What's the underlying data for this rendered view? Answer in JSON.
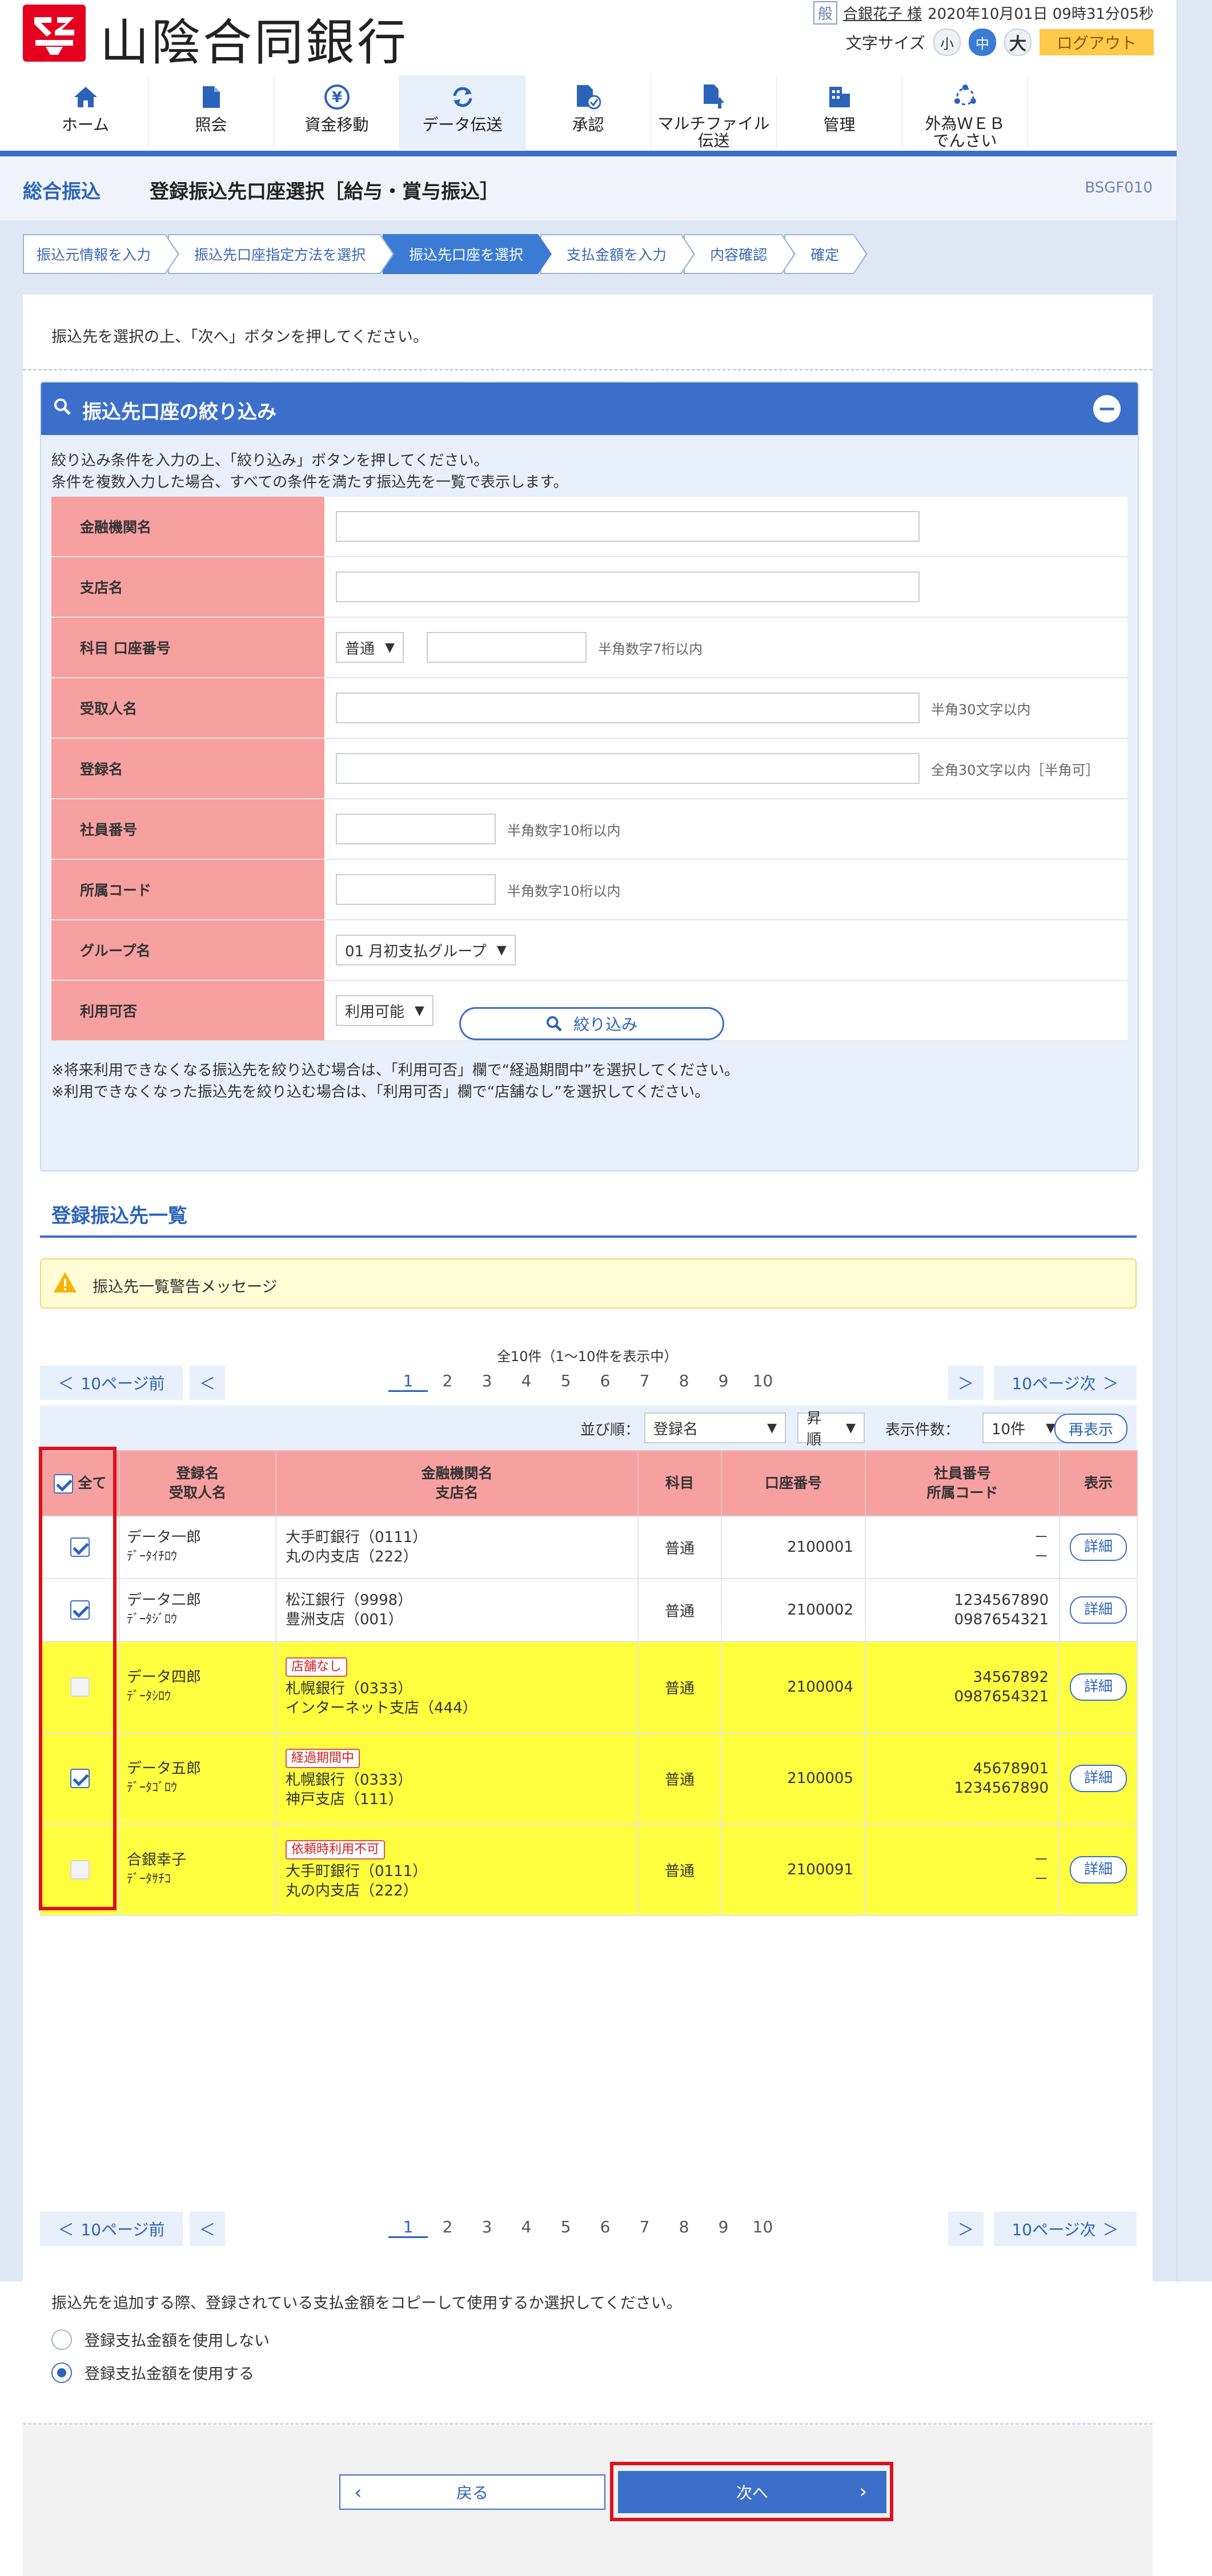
{
  "header": {
    "bank_name": "山陰合同銀行",
    "user_badge": "般",
    "user_name": "合銀花子 様",
    "datetime": "2020年10月01日 09時31分05秒",
    "font_size_label": "文字サイズ",
    "font_small": "小",
    "font_medium": "中",
    "font_large": "大",
    "logout": "ログアウト"
  },
  "nav": {
    "items": [
      {
        "label": "ホーム",
        "icon": "home-icon"
      },
      {
        "label": "照会",
        "icon": "document-icon"
      },
      {
        "label": "資金移動",
        "icon": "yen-transfer-icon"
      },
      {
        "label": "データ伝送",
        "icon": "refresh-icon"
      },
      {
        "label": "承認",
        "icon": "approval-icon"
      },
      {
        "label1": "マルチファイル",
        "label2": "伝送",
        "icon": "file-upload-icon"
      },
      {
        "label": "管理",
        "icon": "building-icon"
      },
      {
        "label1": "外為ＷＥＢ",
        "label2": "でんさい",
        "icon": "network-icon"
      }
    ]
  },
  "title": {
    "category": "総合振込",
    "main": "登録振込先口座選択［給与・賞与振込］",
    "code": "BSGF010"
  },
  "steps": [
    "振込元情報を入力",
    "振込先口座指定方法を選択",
    "振込先口座を選択",
    "支払金額を入力",
    "内容確認",
    "確定"
  ],
  "intro": "振込先を選択の上、「次へ」ボタンを押してください。",
  "filter": {
    "title": "振込先口座の絞り込み",
    "desc1": "絞り込み条件を入力の上、「絞り込み」ボタンを押してください。",
    "desc2": "条件を複数入力した場合、すべての条件を満たす振込先を一覧で表示します。",
    "fields": {
      "bank": "金融機関名",
      "branch": "支店名",
      "account": "科目 口座番号",
      "account_type": "普通",
      "account_hint": "半角数字7桁以内",
      "recipient": "受取人名",
      "recipient_hint": "半角30文字以内",
      "reg_name": "登録名",
      "reg_name_hint": "全角30文字以内［半角可］",
      "emp_no": "社員番号",
      "emp_no_hint": "半角数字10桁以内",
      "dept_code": "所属コード",
      "dept_code_hint": "半角数字10桁以内",
      "group": "グループ名",
      "group_value": "01 月初支払グループ",
      "usable": "利用可否",
      "usable_value": "利用可能"
    },
    "button": "絞り込み",
    "note1": "※将来利用できなくなる振込先を絞り込む場合は、「利用可否」欄で“経過期間中”を選択してください。",
    "note2": "※利用できなくなった振込先を絞り込む場合は、「利用可否」欄で“店舗なし”を選択してください。"
  },
  "list": {
    "title": "登録振込先一覧",
    "warning": "振込先一覧警告メッセージ",
    "count": "全10件（1～10件を表示中）",
    "prev10": "10ページ前",
    "next10": "10ページ次",
    "pages": [
      "1",
      "2",
      "3",
      "4",
      "5",
      "6",
      "7",
      "8",
      "9",
      "10"
    ],
    "sort_label": "並び順：",
    "sort_value": "登録名",
    "order_value": "昇順",
    "per_page_label": "表示件数：",
    "per_page_value": "10件",
    "redisplay": "再表示",
    "headers": {
      "all": "全て",
      "name1": "登録名",
      "name2": "受取人名",
      "bank1": "金融機関名",
      "bank2": "支店名",
      "kamoku": "科目",
      "account": "口座番号",
      "emp1": "社員番号",
      "emp2": "所属コード",
      "view": "表示"
    },
    "rows": [
      {
        "name": "データ一郎",
        "kana": "ﾃﾞｰﾀｲﾁﾛｳ",
        "tag": "",
        "bank": "大手町銀行（0111）",
        "branch": "丸の内支店（222）",
        "kamoku": "普通",
        "account": "2100001",
        "emp": "－",
        "dept": "－",
        "detail": "詳細"
      },
      {
        "name": "データ二郎",
        "kana": "ﾃﾞｰﾀｼﾞﾛｳ",
        "tag": "",
        "bank": "松江銀行（9998）",
        "branch": "豊洲支店（001）",
        "kamoku": "普通",
        "account": "2100002",
        "emp": "1234567890",
        "dept": "0987654321",
        "detail": "詳細"
      },
      {
        "name": "データ四郎",
        "kana": "ﾃﾞｰﾀｼﾛｳ",
        "tag": "店舗なし",
        "bank": "札幌銀行（0333）",
        "branch": "インターネット支店（444）",
        "kamoku": "普通",
        "account": "2100004",
        "emp": "34567892",
        "dept": "0987654321",
        "detail": "詳細"
      },
      {
        "name": "データ五郎",
        "kana": "ﾃﾞｰﾀｺﾞﾛｳ",
        "tag": "経過期間中",
        "bank": "札幌銀行（0333）",
        "branch": "神戸支店（111）",
        "kamoku": "普通",
        "account": "2100005",
        "emp": "45678901",
        "dept": "1234567890",
        "detail": "詳細"
      },
      {
        "name": "合銀幸子",
        "kana": "ﾃﾞｰﾀｻﾁｺ",
        "tag": "依頼時利用不可",
        "bank": "大手町銀行（0111）",
        "branch": "丸の内支店（222）",
        "kamoku": "普通",
        "account": "2100091",
        "emp": "－",
        "dept": "－",
        "detail": "詳細"
      }
    ]
  },
  "copy": {
    "question": "振込先を追加する際、登録されている支払金額をコピーして使用するか選択してください。",
    "option1": "登録支払金額を使用しない",
    "option2": "登録支払金額を使用する"
  },
  "footer": {
    "back": "戻る",
    "next": "次へ"
  }
}
